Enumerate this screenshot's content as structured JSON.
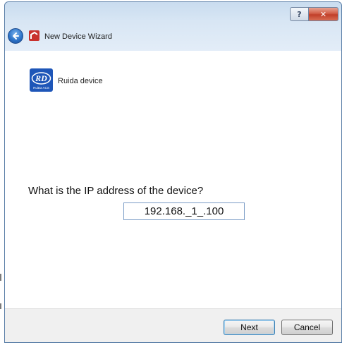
{
  "window": {
    "title": "New Device Wizard",
    "help_label": "?",
    "close_label": "✕"
  },
  "device": {
    "name": "Ruida device",
    "logo_text": "RD",
    "logo_subtext": "RuiDa ACS"
  },
  "form": {
    "question": "What is the IP address of the device?",
    "ip_value": "192.168._1_.100"
  },
  "footer": {
    "next_label": "Next",
    "cancel_label": "Cancel"
  },
  "colors": {
    "accent": "#2e74c9",
    "logo_blue": "#1e56b8",
    "close_red": "#c13f2a"
  }
}
